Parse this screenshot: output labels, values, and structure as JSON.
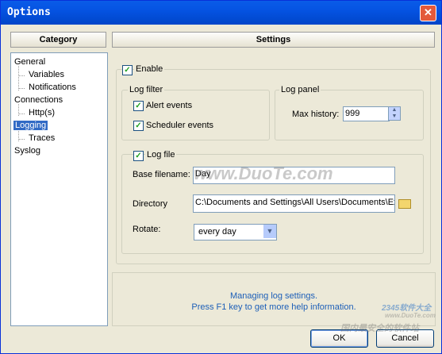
{
  "window": {
    "title": "Options"
  },
  "headers": {
    "category": "Category",
    "settings": "Settings"
  },
  "tree": {
    "general": "General",
    "variables": "Variables",
    "notifications": "Notifications",
    "connections": "Connections",
    "http": "Http(s)",
    "logging": "Logging",
    "traces": "Traces",
    "syslog": "Syslog"
  },
  "settings": {
    "enable_label": "Enable",
    "log_filter_title": "Log filter",
    "alert_events": "Alert events",
    "scheduler_events": "Scheduler events",
    "log_panel_title": "Log panel",
    "max_history_label": "Max history:",
    "max_history_value": "999",
    "log_file_label": "Log file",
    "base_filename_label": "Base filename:",
    "base_filename_value": "Day",
    "directory_label": "Directory",
    "directory_value": "C:\\Documents and Settings\\All Users\\Documents\\Ext",
    "rotate_label": "Rotate:",
    "rotate_value": "every day"
  },
  "info": {
    "line1": "Managing log settings.",
    "line2": "Press F1 key to get more help information."
  },
  "buttons": {
    "ok": "OK",
    "cancel": "Cancel"
  },
  "watermark": {
    "top": "www.DuoTe.com",
    "brand": "2345软件大全",
    "url": "www.DuoTe.com",
    "bottom": "国内最安全的软件站"
  }
}
